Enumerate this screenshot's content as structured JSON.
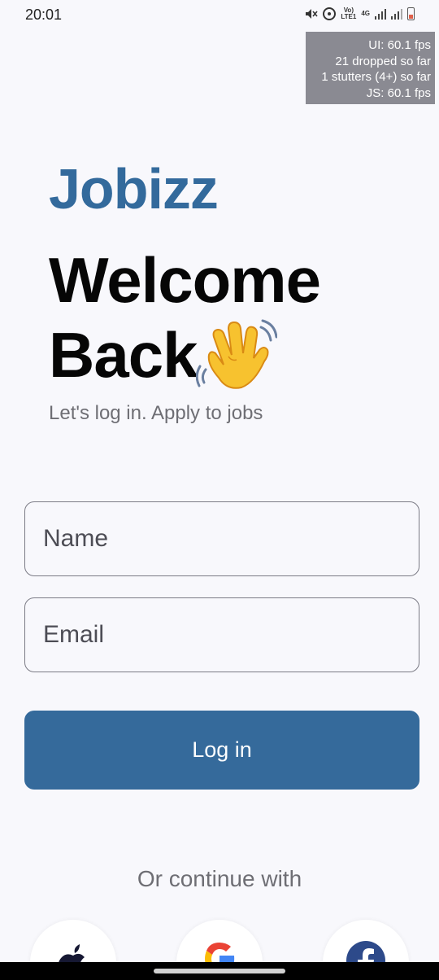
{
  "status_bar": {
    "time": "20:01",
    "network_top": "Vo)",
    "network_bottom": "LTE1",
    "network_type": "4G",
    "icons": [
      "mute-icon",
      "hotspot-icon",
      "volte-icon",
      "signal-icon",
      "signal-icon",
      "battery-icon"
    ]
  },
  "perf_overlay": {
    "ui_fps": "UI: 60.1 fps",
    "dropped": "21 dropped so far",
    "stutters": "1 stutters (4+) so far",
    "js_fps": "JS: 60.1 fps"
  },
  "header": {
    "brand": "Jobizz",
    "welcome_line1": "Welcome",
    "welcome_line2": "Back",
    "wave_icon": "waving-hand-icon",
    "subtitle": "Let's log in. Apply to jobs"
  },
  "form": {
    "name_placeholder": "Name",
    "email_placeholder": "Email",
    "login_label": "Log in"
  },
  "social": {
    "divider_text": "Or continue with",
    "providers": [
      "apple-icon",
      "google-icon",
      "facebook-icon"
    ]
  },
  "colors": {
    "brand": "#336a9c",
    "button": "#356a9b",
    "background": "#f8f8fc"
  }
}
